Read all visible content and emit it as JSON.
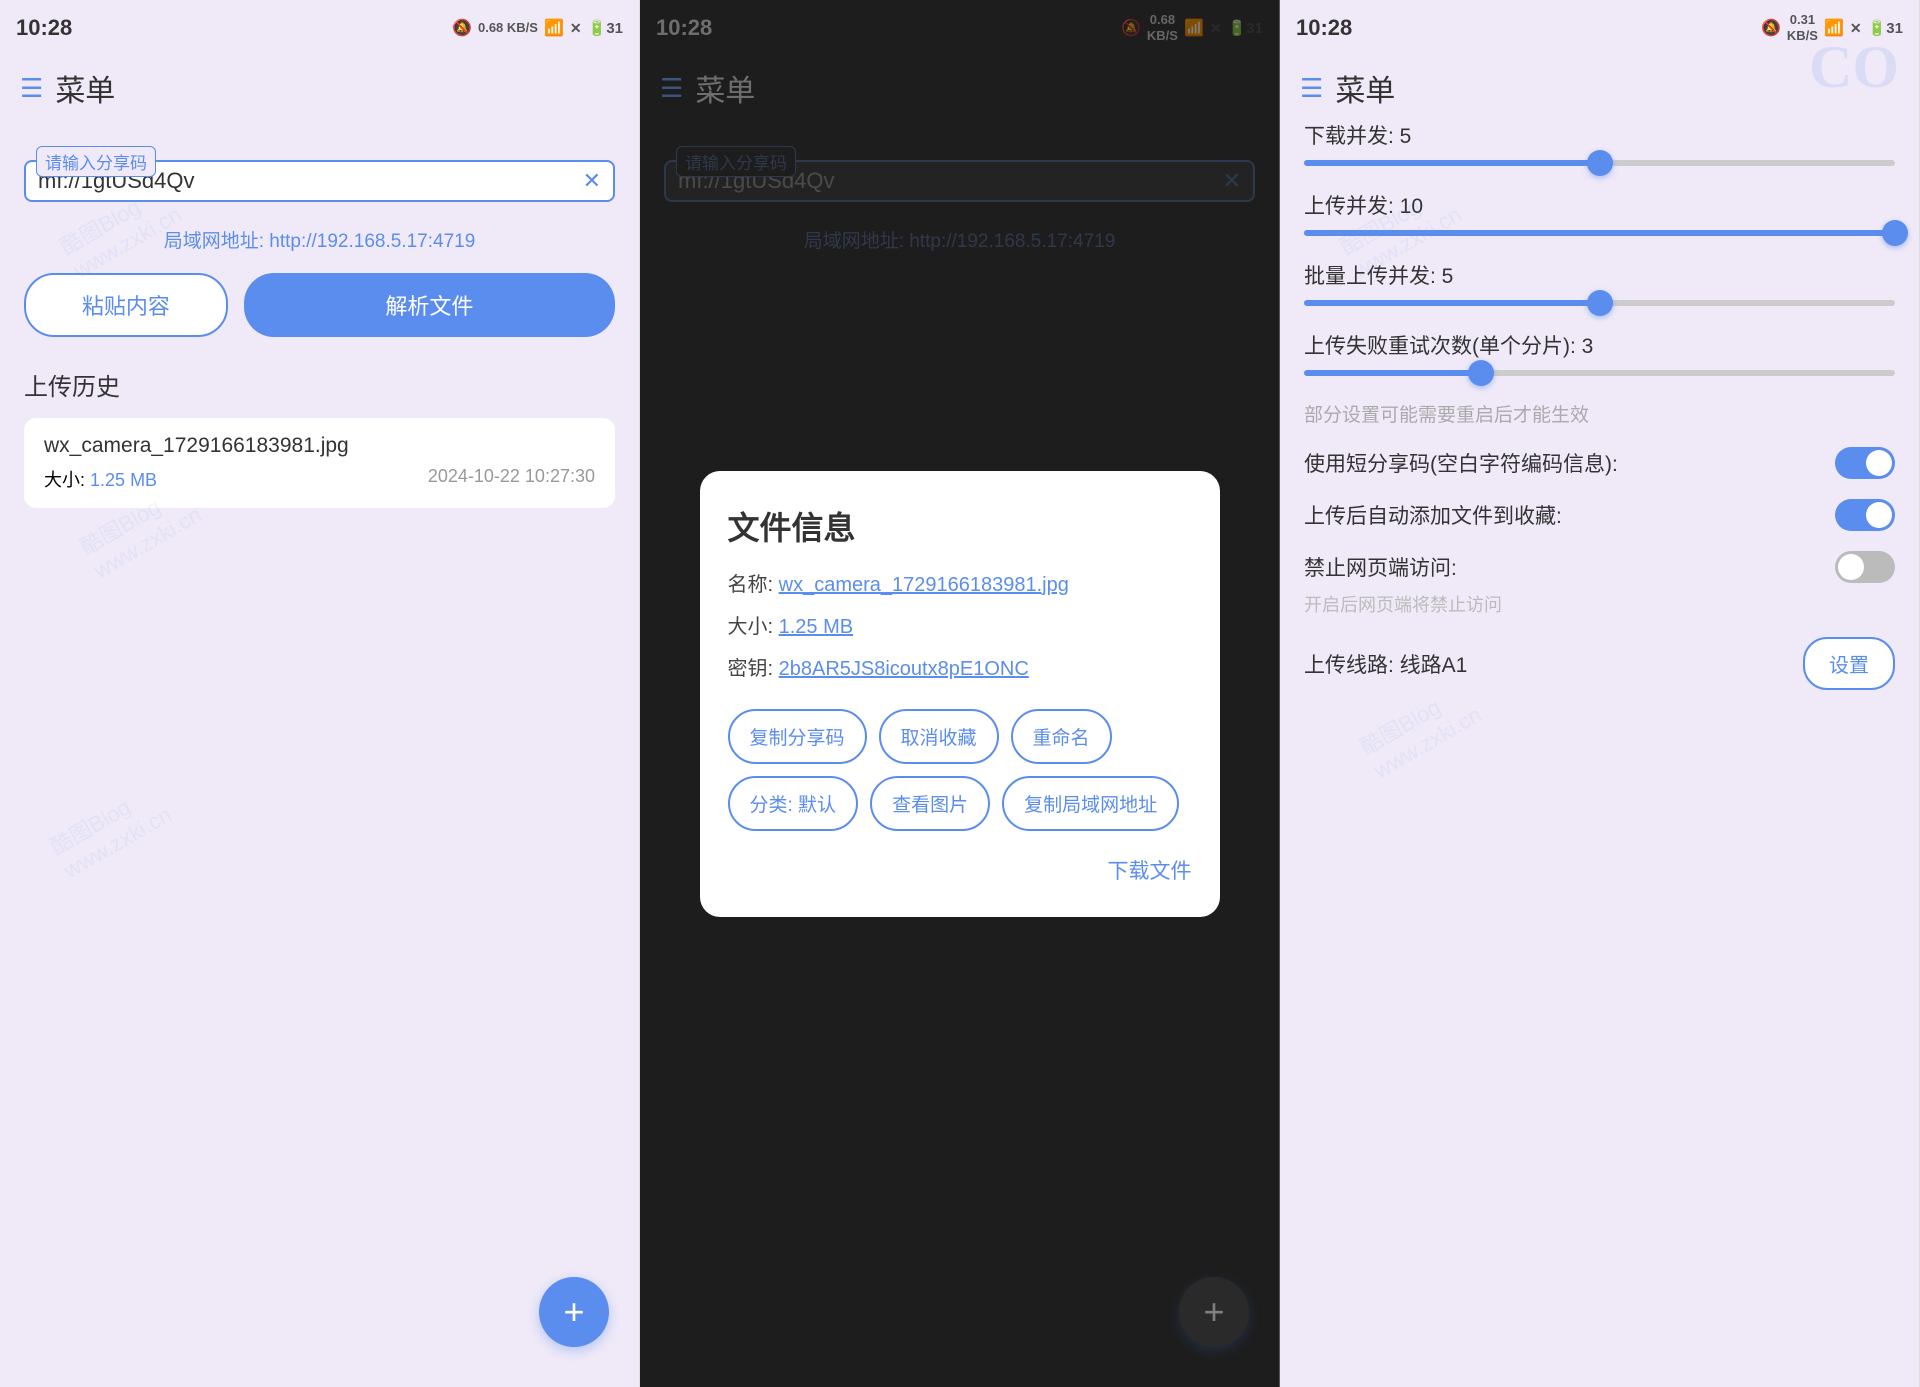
{
  "panel1": {
    "status": {
      "time": "10:28",
      "kbs": "0.68\nKB/S",
      "battery": "31"
    },
    "header": {
      "menu_icon": "☰",
      "title": "菜单"
    },
    "input": {
      "floating_label": "请输入分享码",
      "value": "mf://1gtUSd4Qv",
      "clear_icon": "✕"
    },
    "local_address": "局域网地址: http://192.168.5.17:4719",
    "btn_paste": "粘贴内容",
    "btn_parse": "解析文件",
    "history_title": "上传历史",
    "history_item": {
      "filename": "wx_camera_1729166183981.jpg",
      "size_label": "大小:",
      "size_value": "1.25 MB",
      "date": "2024-10-22 10:27:30"
    },
    "fab_icon": "+"
  },
  "panel2": {
    "status": {
      "time": "10:28",
      "kbs": "0.68\nKB/S",
      "battery": "31"
    },
    "header": {
      "menu_icon": "☰",
      "title": "菜单"
    },
    "input": {
      "floating_label": "请输入分享码",
      "value": "mf://1gtUSd4Qv",
      "clear_icon": "✕"
    },
    "local_address": "局域网地址: http://192.168.5.17:4719",
    "modal": {
      "title": "文件信息",
      "name_label": "名称:",
      "name_value": "wx_camera_1729166183981.jpg",
      "size_label": "大小:",
      "size_value": "1.25 MB",
      "key_label": "密钥:",
      "key_value": "2b8AR5JS8icoutx8pE1ONC",
      "btn_copy_share": "复制分享码",
      "btn_unfavorite": "取消收藏",
      "btn_rename": "重命名",
      "btn_category": "分类: 默认",
      "btn_view_image": "查看图片",
      "btn_copy_local": "复制局域网地址",
      "btn_download": "下载文件"
    },
    "fab_icon": "+"
  },
  "panel3": {
    "status": {
      "time": "10:28",
      "kbs": "0.31\nKB/S",
      "battery": "31"
    },
    "header": {
      "menu_icon": "☰",
      "title": "菜单"
    },
    "settings": {
      "download_concurrent_label": "下载并发: 5",
      "download_concurrent_value": 50,
      "upload_concurrent_label": "上传并发: 10",
      "upload_concurrent_value": 100,
      "batch_upload_label": "批量上传并发: 5",
      "batch_upload_value": 50,
      "retry_label": "上传失败重试次数(单个分片): 3",
      "retry_value": 30,
      "note": "部分设置可能需要重启后才能生效",
      "short_code_label": "使用短分享码(空白字符编码信息):",
      "short_code_on": true,
      "auto_fav_label": "上传后自动添加文件到收藏:",
      "auto_fav_on": true,
      "block_web_label": "禁止网页端访问:",
      "block_web_on": false,
      "block_web_note": "开启后网页端将禁止访问",
      "route_label": "上传线路: 线路A1",
      "route_btn": "设置"
    }
  }
}
